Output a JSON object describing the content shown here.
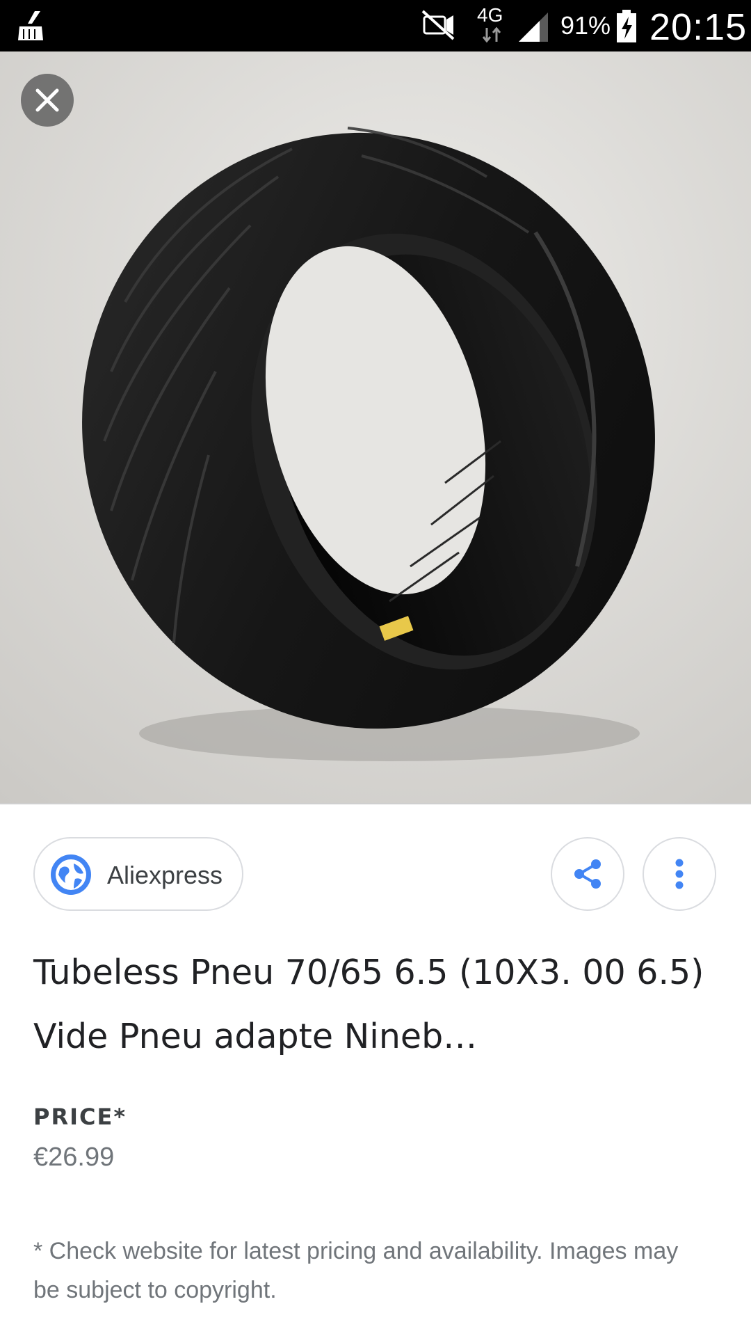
{
  "status_bar": {
    "network_type": "4G",
    "battery_percent": "91%",
    "time": "20:15",
    "icons": [
      "cleaner-icon",
      "mute-icon",
      "data-arrows-icon",
      "signal-icon",
      "battery-charging-icon"
    ]
  },
  "viewer": {
    "close_icon": "close-icon",
    "image_subject": "product-image"
  },
  "source": {
    "name": "Aliexpress",
    "icon": "globe-icon"
  },
  "actions": {
    "share_icon": "share-icon",
    "more_icon": "more-vert-icon"
  },
  "product": {
    "title": "Tubeless Pneu 70/65 6.5 (10X3. 00 6.5) Vide Pneu adapte Nineb…",
    "price_label": "PRICE*",
    "price": "€26.99"
  },
  "disclaimer": "* Check website for latest pricing and availability. Images may be subject to copyright.",
  "colors": {
    "status_bar_bg": "#000000",
    "accent_blue": "#4285f4",
    "chip_border": "#dadce0",
    "secondary_text": "#70757a",
    "primary_text": "#202124"
  }
}
